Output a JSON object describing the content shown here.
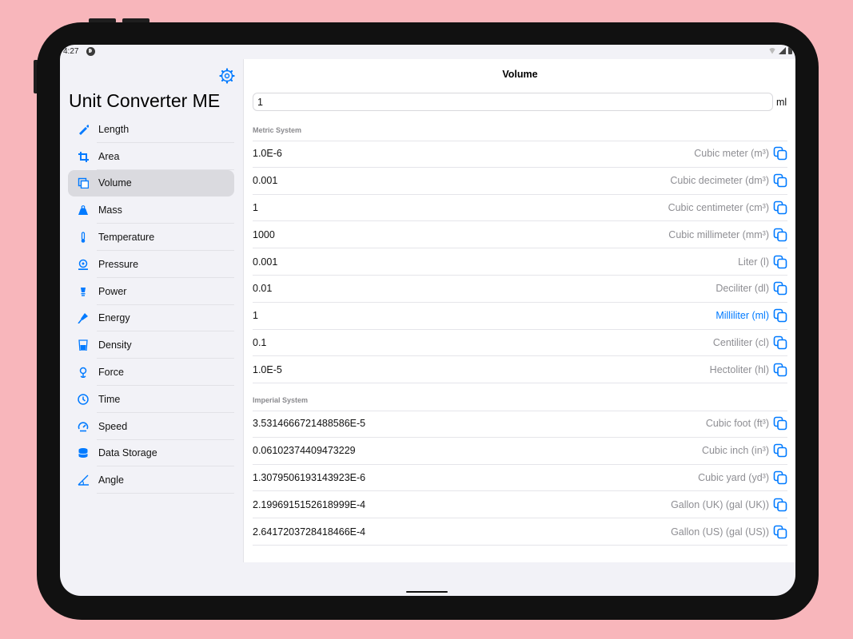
{
  "statusbar": {
    "time": "4:27"
  },
  "sidebar": {
    "title": "Unit Converter ME",
    "items": [
      {
        "label": "Length",
        "icon": "ruler-icon"
      },
      {
        "label": "Area",
        "icon": "crop-icon"
      },
      {
        "label": "Volume",
        "icon": "volume-icon",
        "selected": true
      },
      {
        "label": "Mass",
        "icon": "weight-icon"
      },
      {
        "label": "Temperature",
        "icon": "thermometer-icon"
      },
      {
        "label": "Pressure",
        "icon": "pressure-icon"
      },
      {
        "label": "Power",
        "icon": "bulb-icon"
      },
      {
        "label": "Energy",
        "icon": "energy-icon"
      },
      {
        "label": "Density",
        "icon": "density-icon"
      },
      {
        "label": "Force",
        "icon": "force-icon"
      },
      {
        "label": "Time",
        "icon": "clock-icon"
      },
      {
        "label": "Speed",
        "icon": "speedometer-icon"
      },
      {
        "label": "Data Storage",
        "icon": "database-icon"
      },
      {
        "label": "Angle",
        "icon": "angle-icon"
      }
    ]
  },
  "main": {
    "title": "Volume",
    "input_value": "1",
    "input_unit": "ml",
    "sections": [
      {
        "header": "Metric System",
        "rows": [
          {
            "value": "1.0E-6",
            "unit": "Cubic meter (m³)"
          },
          {
            "value": "0.001",
            "unit": "Cubic decimeter (dm³)"
          },
          {
            "value": "1",
            "unit": "Cubic centimeter (cm³)"
          },
          {
            "value": "1000",
            "unit": "Cubic millimeter (mm³)"
          },
          {
            "value": "0.001",
            "unit": "Liter (l)"
          },
          {
            "value": "0.01",
            "unit": "Deciliter (dl)"
          },
          {
            "value": "1",
            "unit": "Milliliter (ml)",
            "active": true
          },
          {
            "value": "0.1",
            "unit": "Centiliter (cl)"
          },
          {
            "value": "1.0E-5",
            "unit": "Hectoliter (hl)"
          }
        ]
      },
      {
        "header": "Imperial System",
        "rows": [
          {
            "value": "3.5314666721488586E-5",
            "unit": "Cubic foot (ft³)"
          },
          {
            "value": "0.06102374409473229",
            "unit": "Cubic inch (in³)"
          },
          {
            "value": "1.3079506193143923E-6",
            "unit": "Cubic yard (yd³)"
          },
          {
            "value": "2.1996915152618999E-4",
            "unit": "Gallon (UK) (gal (UK))"
          },
          {
            "value": "2.6417203728418466E-4",
            "unit": "Gallon (US) (gal (US))"
          }
        ]
      }
    ]
  },
  "colors": {
    "accent": "#007aff",
    "background": "#f8b6bb",
    "selected_row": "#dadadf"
  }
}
